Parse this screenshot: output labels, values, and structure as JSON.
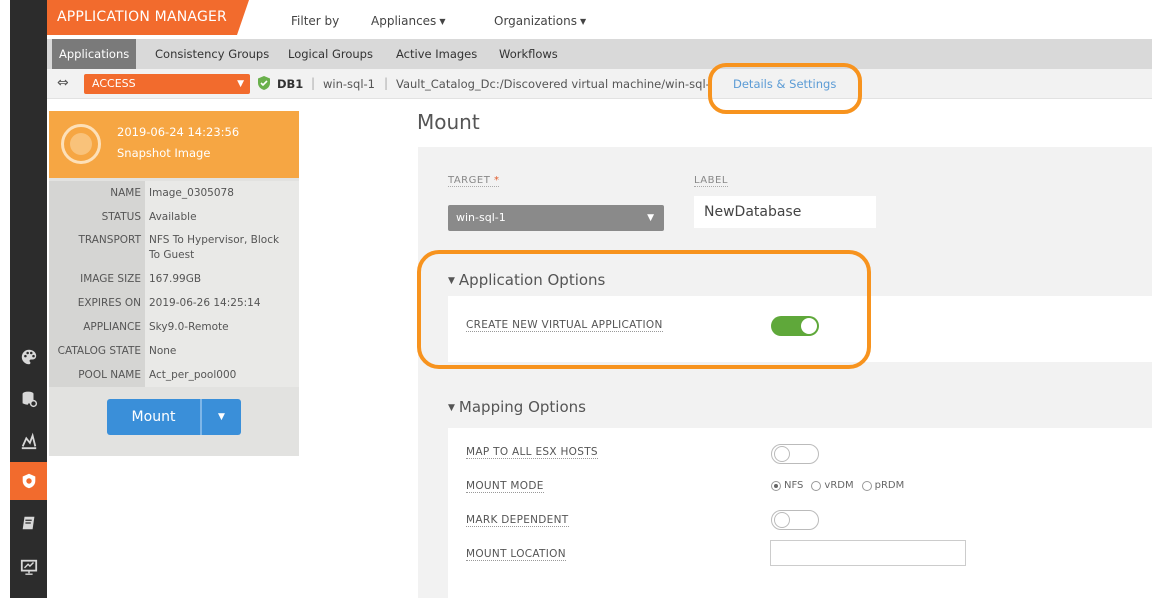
{
  "header": {
    "app_title": "APPLICATION MANAGER",
    "filter_by": "Filter by",
    "appliances": "Appliances",
    "organizations": "Organizations"
  },
  "tabs": [
    {
      "label": "Applications",
      "active": true
    },
    {
      "label": "Consistency Groups"
    },
    {
      "label": "Logical Groups"
    },
    {
      "label": "Active Images"
    },
    {
      "label": "Workflows"
    }
  ],
  "breadcrumb": {
    "access": "ACCESS",
    "db": "DB1",
    "host": "win-sql-1",
    "path": "Vault_Catalog_Dc:/Discovered virtual machine/win-sql-",
    "details_link": "Details & Settings"
  },
  "snapshot": {
    "date": "2019-06-24  14:23:56",
    "type": "Snapshot Image",
    "properties": [
      {
        "key": "NAME",
        "value": "Image_0305078"
      },
      {
        "key": "STATUS",
        "value": "Available"
      },
      {
        "key": "TRANSPORT",
        "value": "NFS To Hypervisor, Block To Guest"
      },
      {
        "key": "IMAGE SIZE",
        "value": "167.99GB"
      },
      {
        "key": "EXPIRES ON",
        "value": "2019-06-26 14:25:14"
      },
      {
        "key": "APPLIANCE",
        "value": "Sky9.0-Remote"
      },
      {
        "key": "CATALOG STATE",
        "value": "None"
      },
      {
        "key": "POOL NAME",
        "value": "Act_per_pool000"
      }
    ],
    "mount_button": "Mount"
  },
  "main": {
    "title": "Mount",
    "target_label": "TARGET",
    "target_required": "*",
    "target_value": "win-sql-1",
    "label_label": "LABEL",
    "label_value": "NewDatabase"
  },
  "application_options": {
    "heading": "Application Options",
    "create_new_virtual_application": {
      "label": "CREATE NEW VIRTUAL APPLICATION",
      "enabled": true
    }
  },
  "mapping_options": {
    "heading": "Mapping Options",
    "map_to_all_esx_hosts": {
      "label": "MAP TO ALL ESX HOSTS",
      "enabled": false
    },
    "mount_mode": {
      "label": "MOUNT MODE",
      "options": [
        "NFS",
        "vRDM",
        "pRDM"
      ],
      "selected": "NFS"
    },
    "mark_dependent": {
      "label": "MARK DEPENDENT",
      "enabled": false
    },
    "mount_location": {
      "label": "MOUNT LOCATION",
      "value": ""
    }
  },
  "colors": {
    "accent": "#f26b2d",
    "highlight_ring": "#f7931e",
    "snapshot_header": "#f6a643",
    "primary_button": "#3a8fd9",
    "toggle_on": "#5fa83a"
  },
  "icons": {
    "rail": [
      "palette-icon",
      "database-settings-icon",
      "chart-icon",
      "shield-icon",
      "book-icon",
      "monitor-icon"
    ],
    "breadcrumb": [
      "swap-arrows-icon",
      "shield-check-icon"
    ]
  }
}
